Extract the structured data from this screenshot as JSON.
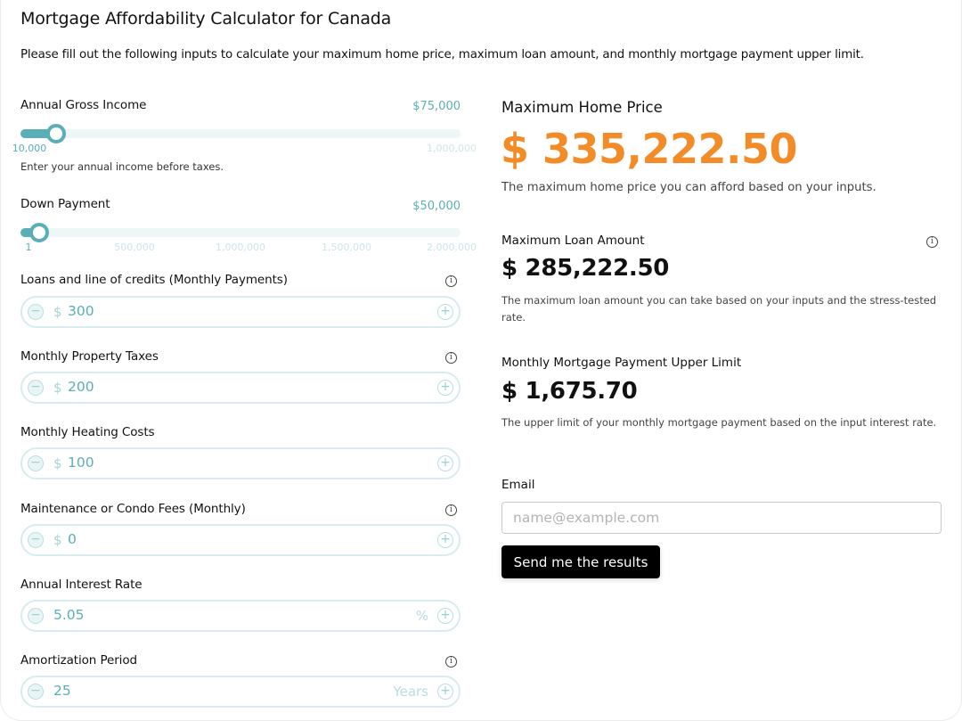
{
  "header": {
    "title": "Mortgage Affordability Calculator for Canada",
    "subtitle": "Please fill out the following inputs to calculate your maximum home price, maximum loan amount, and monthly mortgage payment upper limit."
  },
  "inputs": {
    "income": {
      "label": "Annual Gross Income",
      "value_display": "$75,000",
      "value": 75000,
      "min": 10000,
      "max": 1000000,
      "ticks": [
        "10,000",
        "1,000,000"
      ],
      "hint": "Enter your annual income before taxes."
    },
    "down_payment": {
      "label": "Down Payment",
      "value_display": "$50,000",
      "value": 50000,
      "min": 1,
      "max": 2000000,
      "ticks": [
        "1",
        "500,000",
        "1,000,000",
        "1,500,000",
        "2,000,000"
      ]
    },
    "loans": {
      "label": "Loans and line of credits (Monthly Payments)",
      "prefix": "$",
      "value": "300",
      "info_icon": "info-icon"
    },
    "property_taxes": {
      "label": "Monthly Property Taxes",
      "prefix": "$",
      "value": "200",
      "info_icon": "info-icon"
    },
    "heating": {
      "label": "Monthly Heating Costs",
      "prefix": "$",
      "value": "100"
    },
    "condo_fees": {
      "label": "Maintenance or Condo Fees (Monthly)",
      "prefix": "$",
      "value": "0",
      "info_icon": "info-icon"
    },
    "interest_rate": {
      "label": "Annual Interest Rate",
      "value": "5.05",
      "suffix": "%"
    },
    "amortization": {
      "label": "Amortization Period",
      "value": "25",
      "suffix": "Years",
      "info_icon": "info-icon"
    },
    "minus_symbol": "−",
    "plus_symbol": "+",
    "info_symbol": "i"
  },
  "results": {
    "home_price": {
      "label": "Maximum Home Price",
      "value": "$ 335,222.50",
      "description": "The maximum home price you can afford based on your inputs."
    },
    "loan_amount": {
      "label": "Maximum Loan Amount",
      "value": "$ 285,222.50",
      "description": "The maximum loan amount you can take based on your inputs and the stress-tested rate."
    },
    "monthly_payment": {
      "label": "Monthly Mortgage Payment Upper Limit",
      "value": "$ 1,675.70",
      "description": "The upper limit of your monthly mortgage payment based on the input interest rate."
    }
  },
  "email": {
    "label": "Email",
    "placeholder": "name@example.com",
    "value": "",
    "submit_label": "Send me the results"
  },
  "colors": {
    "accent": "#5aaeb8",
    "highlight": "#f28c28",
    "button": "#000000"
  }
}
